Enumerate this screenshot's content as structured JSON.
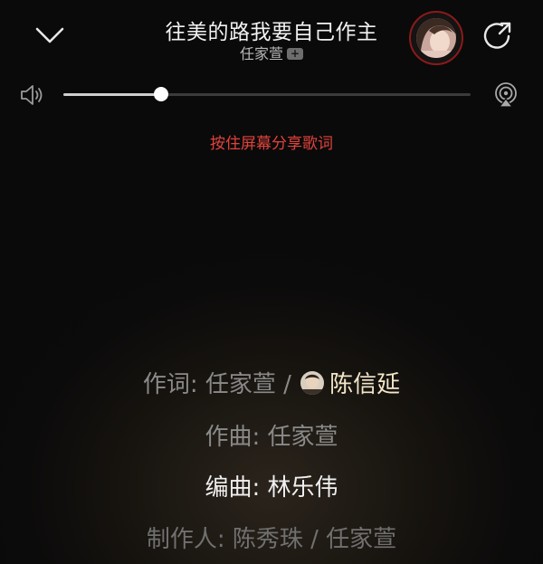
{
  "header": {
    "song_title": "往美的路我要自己作主",
    "artist": "任家萱",
    "artist_badge": "+"
  },
  "lyrics_hint": "按住屏幕分享歌词",
  "volume": {
    "level": 0.24
  },
  "credits": {
    "lyricist": {
      "label": "作词:",
      "names": [
        "任家萱",
        "陈信延"
      ],
      "separator": "/"
    },
    "composer": {
      "label": "作曲:",
      "name": "任家萱"
    },
    "arranger": {
      "label": "编曲:",
      "name": "林乐伟"
    },
    "producer": {
      "label": "制作人:",
      "names": [
        "陈秀珠",
        "任家萱"
      ],
      "separator": "/"
    }
  },
  "icons": {
    "collapse": "chevron-down-icon",
    "share": "share-arrow-icon",
    "volume": "speaker-icon",
    "airplay": "airplay-icon"
  },
  "colors": {
    "accent_red": "#e2423c",
    "avatar_ring": "#8b1a1a",
    "active_text": "#f0f0f0",
    "inactive_text": "#8a8a8a"
  }
}
